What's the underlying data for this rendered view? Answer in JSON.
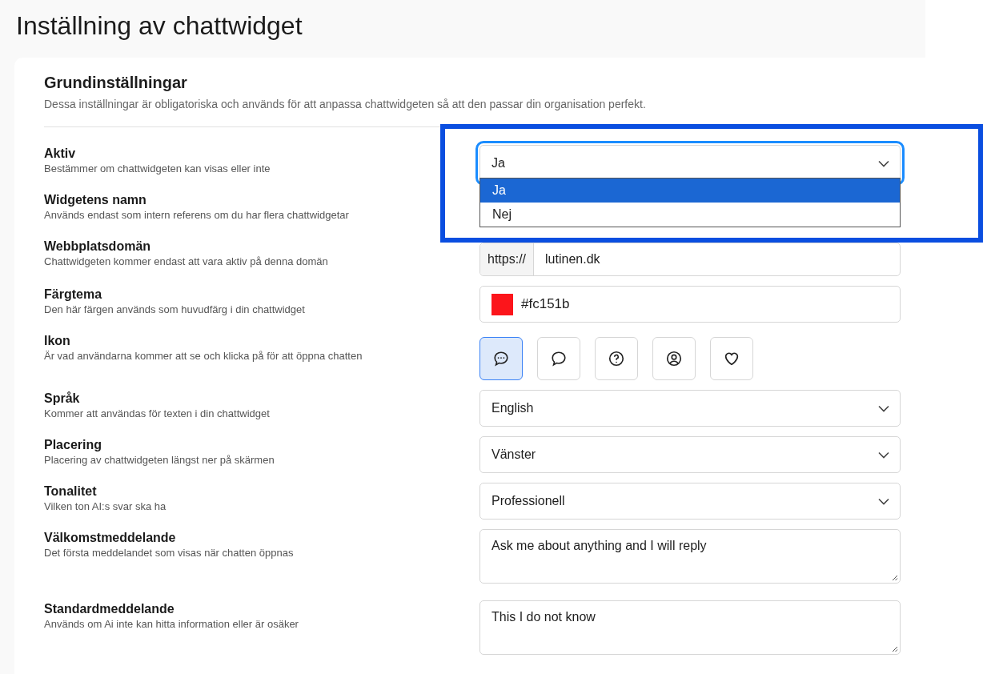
{
  "page": {
    "title": "Inställning av chattwidget"
  },
  "section": {
    "title": "Grundinställningar",
    "description": "Dessa inställningar är obligatoriska och används för att anpassa chattwidgeten så att den passar din organisation perfekt."
  },
  "fields": [
    {
      "kind": "select",
      "label": "Aktiv",
      "hint": "Bestämmer om chattwidgeten kan visas eller inte",
      "value": "Ja",
      "open": true,
      "options": [
        {
          "label": "Ja",
          "selected": true
        },
        {
          "label": "Nej",
          "selected": false
        }
      ]
    },
    {
      "kind": "covered",
      "label": "Widgetens namn",
      "hint": "Används endast som intern referens om du har flera chattwidgetar"
    },
    {
      "kind": "url",
      "label": "Webbplatsdomän",
      "hint": "Chattwidgeten kommer endast att vara aktiv på denna domän",
      "prefix": "https://",
      "value": "lutinen.dk"
    },
    {
      "kind": "color",
      "label": "Färgtema",
      "hint": "Den här färgen används som huvudfärg i din chattwidget",
      "color": "#fc151b",
      "value": "#fc151b"
    },
    {
      "kind": "icons",
      "label": "Ikon",
      "hint": "Är vad användarna kommer att se och klicka på för att öppna chatten",
      "icons": [
        {
          "kind": "dots",
          "selected": true
        },
        {
          "kind": "bubble",
          "selected": false
        },
        {
          "kind": "question",
          "selected": false
        },
        {
          "kind": "user",
          "selected": false
        },
        {
          "kind": "heart",
          "selected": false
        }
      ]
    },
    {
      "kind": "select",
      "label": "Språk",
      "hint": "Kommer att användas för texten i din chattwidget",
      "value": "English",
      "open": false
    },
    {
      "kind": "select",
      "label": "Placering",
      "hint": "Placering av chattwidgeten längst ner på skärmen",
      "value": "Vänster",
      "open": false
    },
    {
      "kind": "select",
      "label": "Tonalitet",
      "hint": "Vilken ton AI:s svar ska ha",
      "value": "Professionell",
      "open": false
    },
    {
      "kind": "textarea",
      "label": "Välkomstmeddelande",
      "hint": "Det första meddelandet som visas när chatten öppnas",
      "value": "Ask me about anything and I will reply"
    },
    {
      "kind": "textarea",
      "label": "Standardmeddelande",
      "hint": "Används om Ai inte kan hitta information eller är osäker",
      "value": "This I do not know"
    }
  ]
}
